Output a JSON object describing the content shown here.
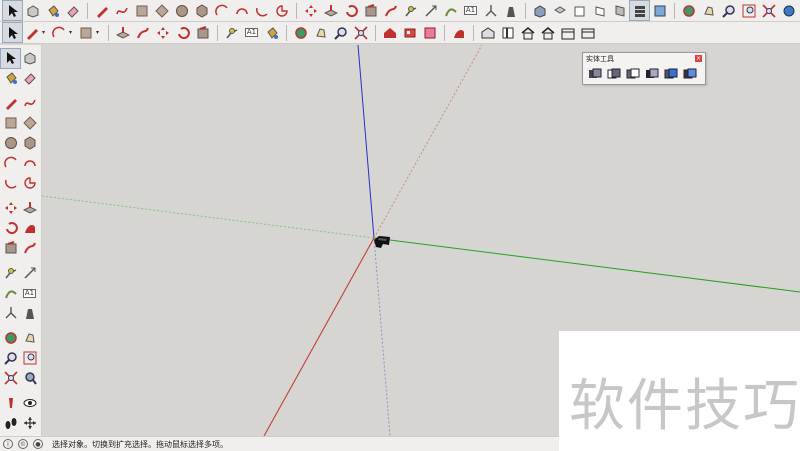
{
  "app": {
    "solid_tools_panel_title": "实体工具",
    "solid_tools_close_glyph": "×",
    "status_text": "选择对象。切换到扩充选择。拖动鼠标选择多项。",
    "watermark_text": "软件技巧",
    "text_tool_glyph": "A1"
  },
  "colors": {
    "red_axis": "#c0302c",
    "green_axis": "#23a020",
    "blue_axis": "#2b2bd0",
    "selection_highlight": "#d6dbe2"
  },
  "toolbar_row1": [
    "select-icon",
    "component-icon",
    "paint-bucket-icon",
    "eraser-icon",
    "pencil-icon",
    "freehand-icon",
    "rectangle-icon",
    "rotated-rectangle-icon",
    "circle-icon",
    "polygon-icon",
    "arc-icon",
    "two-point-arc-icon",
    "three-point-arc-icon",
    "pie-icon",
    "move-icon",
    "push-pull-icon",
    "rotate-icon",
    "follow-me-icon",
    "scale-icon",
    "offset-icon",
    "tape-measure-icon",
    "dimension-icon",
    "protractor-icon",
    "text-icon",
    "axes-icon",
    "3d-text-icon",
    "iso-view-icon",
    "top-view-icon",
    "front-view-icon",
    "right-view-icon",
    "back-view-icon",
    "left-view-icon",
    "section-plane-icon",
    "orbit-icon",
    "pan-icon",
    "zoom-icon",
    "zoom-window-icon",
    "zoom-extents-icon",
    "previous-view-icon",
    "next-view-icon"
  ],
  "toolbar_row2": [
    "select-icon",
    "pencil-icon",
    "arc-icon",
    "push-pull-icon",
    "follow-me-icon",
    "rotate-icon",
    "offset-icon",
    "tape-measure-icon",
    "text-icon",
    "paint-bucket-icon",
    "orbit-icon",
    "zoom-icon",
    "zoom-extents-icon",
    "warehouse-icon",
    "extension-icon",
    "sandbox-icon",
    "door-icon",
    "house-icon",
    "home-icon",
    "camera-icon",
    "gallery-icon"
  ]
}
